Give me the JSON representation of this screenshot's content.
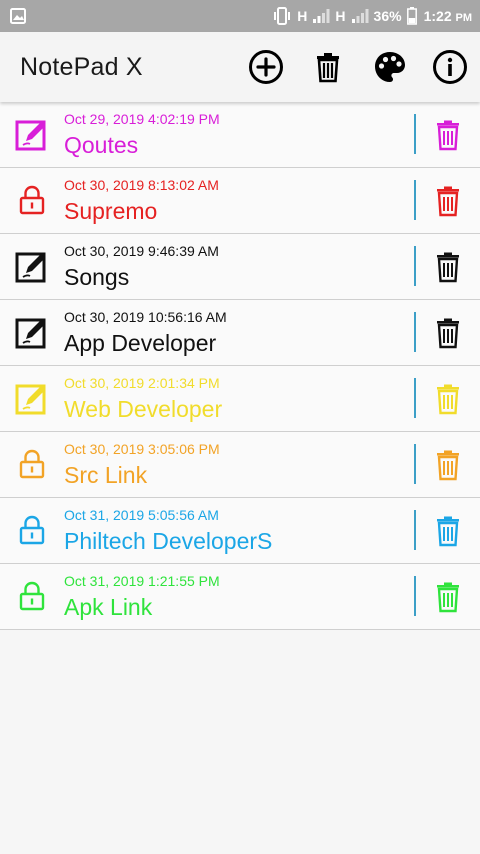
{
  "status_bar": {
    "network_1": "H",
    "network_2": "H",
    "battery": "36%",
    "time": "1:22",
    "ampm": "PM"
  },
  "app_bar": {
    "title": "NotePad X",
    "actions": [
      "add-icon",
      "trash-icon",
      "palette-icon",
      "info-icon"
    ]
  },
  "notes": [
    {
      "date": "Oct 29, 2019 4:02:19 PM",
      "title": "Qoutes",
      "icon": "edit-icon",
      "color": "#d81ed8"
    },
    {
      "date": "Oct 30, 2019 8:13:02 AM",
      "title": "Supremo",
      "icon": "lock-icon",
      "color": "#e52222"
    },
    {
      "date": "Oct 30, 2019 9:46:39 AM",
      "title": "Songs",
      "icon": "edit-icon",
      "color": "#111111"
    },
    {
      "date": "Oct 30, 2019 10:56:16 AM",
      "title": "App Developer",
      "icon": "edit-icon",
      "color": "#111111"
    },
    {
      "date": "Oct 30, 2019 2:01:34 PM",
      "title": "Web Developer",
      "icon": "edit-icon",
      "color": "#f1dc2b"
    },
    {
      "date": "Oct 30, 2019 3:05:06 PM",
      "title": "Src Link",
      "icon": "lock-icon",
      "color": "#f2a326"
    },
    {
      "date": "Oct 31, 2019 5:05:56 AM",
      "title": "Philtech DeveloperS",
      "icon": "lock-icon",
      "color": "#1ba6e6"
    },
    {
      "date": "Oct 31, 2019 1:21:55 PM",
      "title": "Apk Link",
      "icon": "lock-icon",
      "color": "#2fe33c"
    }
  ]
}
